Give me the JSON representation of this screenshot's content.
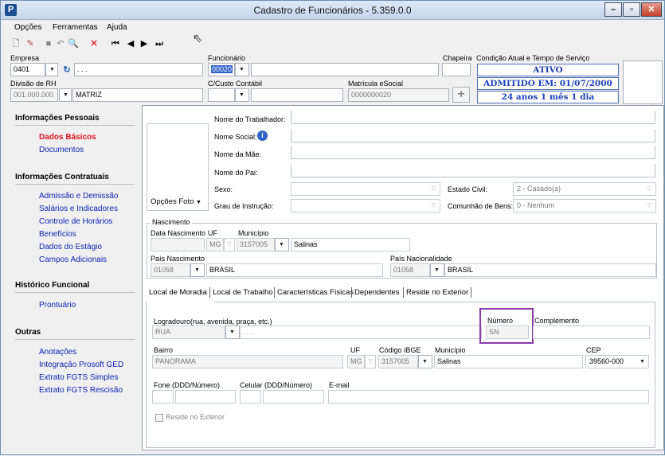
{
  "window": {
    "title": "Cadastro de Funcionários - 5.359.0.0",
    "icon_letter": "P"
  },
  "menu": [
    "Opções",
    "Ferramentas",
    "Ajuda"
  ],
  "header": {
    "empresa_label": "Empresa",
    "empresa_code": "0401",
    "empresa_name": ". . .",
    "funcionario_label": "Funcionário",
    "funcionario_code": "00020",
    "chapeira_label": "Chapeira",
    "condicao_label": "Condição Atual e Tempo de Serviço",
    "status_ativo": "ATIVO",
    "status_admitido": "ADMITIDO EM: 01/07/2000",
    "status_tempo": "24 anos 1 mês 1 dia",
    "divisao_label": "Divisão de RH",
    "divisao_code": "001.000.000",
    "divisao_name": "MATRIZ",
    "ccusto_label": "C/Custo Contábil",
    "matricula_label": "Matrícula eSocial",
    "matricula_value": "0000000020"
  },
  "sidebar": {
    "sections": [
      {
        "title": "Informações Pessoais",
        "items": [
          "Dados Básicos",
          "Documentos"
        ]
      },
      {
        "title": "Informações Contratuais",
        "items": [
          "Admissão e Demissão",
          "Salários e Indicadores",
          "Controle de Horários",
          "Benefícios",
          "Dados do Estágio",
          "Campos Adicionais"
        ]
      },
      {
        "title": "Histórico Funcional",
        "items": [
          "Prontuário"
        ]
      },
      {
        "title": "Outras",
        "items": [
          "Anotações",
          "Integração Prosoft GED",
          "Extrato FGTS Simples",
          "Extrato FGTS Rescisão"
        ]
      }
    ]
  },
  "basic": {
    "nome_trabalhador": "Nome do Trabalhador:",
    "nome_social": "Nome Social:",
    "nome_mae": "Nome da Mãe:",
    "nome_pai": "Nome do Pai:",
    "sexo": "Sexo:",
    "grau": "Grau de Instrução:",
    "estado_civil_label": "Estado Civil:",
    "estado_civil_value": "2 - Casado(a)",
    "comunhao_label": "Comunhão de Bens:",
    "comunhao_value": "0 - Nenhum",
    "opcoes_foto": "Opções Foto"
  },
  "nascimento": {
    "group": "Nascimento",
    "data_label": "Data Nascimento",
    "uf_label": "UF",
    "uf_value": "MG",
    "municipio_label": "Município",
    "municipio_code": "3157005",
    "municipio_name": "Salinas",
    "pais_label": "País Nascimento",
    "pais_code": "01058",
    "pais_name": "BRASIL",
    "nacionalidade_label": "País Nacionalidade",
    "nacionalidade_code": "01058",
    "nacionalidade_name": "BRASIL"
  },
  "tabs": [
    "Local de Moradia",
    "Local de Trabalho",
    "Características Físicas",
    "Dependentes",
    "Reside no Exterior"
  ],
  "moradia": {
    "logradouro_label": "Logradouro(rua, avenida, praça, etc.)",
    "logradouro_tipo": "RUA",
    "logradouro_nome": ". . .",
    "numero_label": "Número",
    "numero_value": "SN",
    "complemento_label": "Complemento",
    "bairro_label": "Bairro",
    "bairro_value": "PANORAMA",
    "uf_label": "UF",
    "uf_value": "MG",
    "ibge_label": "Código IBGE",
    "ibge_value": "3157005",
    "municipio_label": "Município",
    "municipio_value": "Salinas",
    "cep_label": "CEP",
    "cep_value": "39560-000",
    "fone_label": "Fone (DDD/Número)",
    "celular_label": "Celular (DDD/Número)",
    "email_label": "E-mail",
    "reside_exterior": "Reside no Exterior"
  },
  "colors": {
    "accent": "#1d3fbf",
    "active": "#e0141c",
    "link": "#0a1fb5",
    "highlight": "#8b3aa8"
  }
}
